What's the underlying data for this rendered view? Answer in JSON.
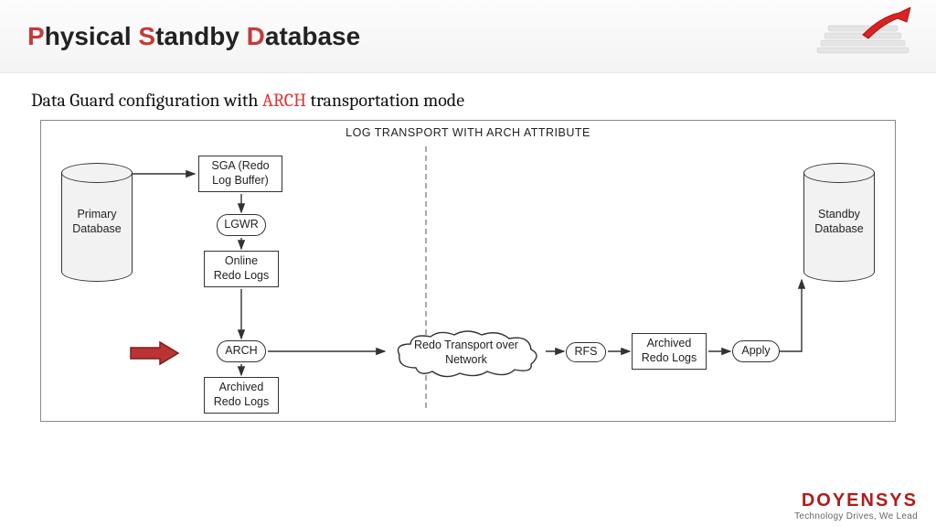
{
  "header": {
    "title_parts": {
      "p": "P",
      "hysical": "hysical ",
      "s": "S",
      "tandby": "tandby ",
      "d": "D",
      "atabase": "atabase"
    }
  },
  "subtitle": {
    "pre": "Data Guard configuration with ",
    "accent": "ARCH",
    "post": " transportation mode"
  },
  "diagram": {
    "title": "LOG TRANSPORT WITH ARCH ATTRIBUTE",
    "primary_db": "Primary\nDatabase",
    "standby_db": "Standby\nDatabase",
    "sga": "SGA (Redo\nLog Buffer)",
    "lgwr": "LGWR",
    "online_redo": "Online\nRedo Logs",
    "arch": "ARCH",
    "archived_redo": "Archived\nRedo Logs",
    "cloud": "Redo Transport over\nNetwork",
    "rfs": "RFS",
    "archived_redo2": "Archived\nRedo Logs",
    "apply": "Apply"
  },
  "footer": {
    "brand": "DOYENSYS",
    "tag": "Technology Drives, We Lead"
  }
}
